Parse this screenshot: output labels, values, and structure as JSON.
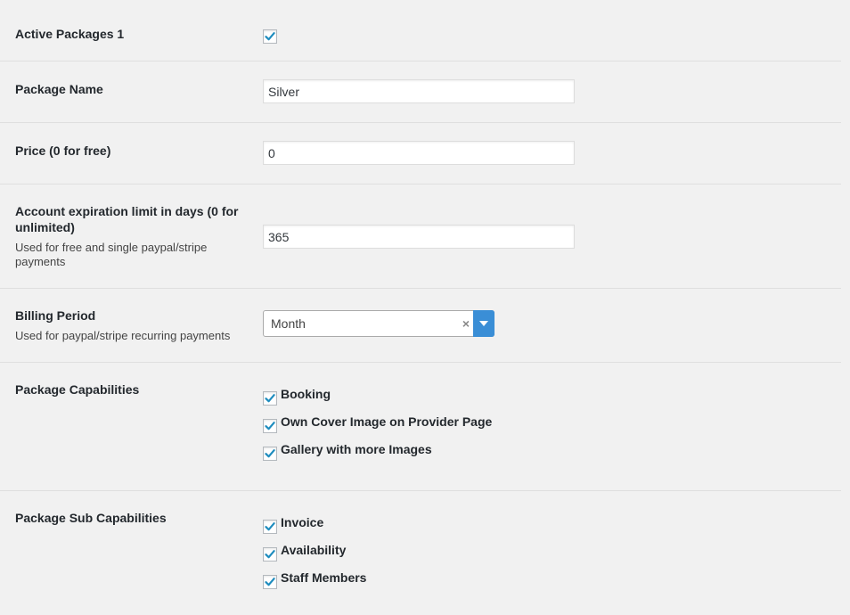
{
  "active_packages": {
    "label": "Active Packages 1",
    "checked": true
  },
  "package_name": {
    "label": "Package Name",
    "value": "Silver"
  },
  "price": {
    "label": "Price (0 for free)",
    "value": "0"
  },
  "expiration": {
    "label": "Account expiration limit in days (0 for unlimited)",
    "description": "Used for free and single paypal/stripe payments",
    "value": "365"
  },
  "billing_period": {
    "label": "Billing Period",
    "description": "Used for paypal/stripe recurring payments",
    "selected": "Month",
    "clear_symbol": "×"
  },
  "capabilities": {
    "label": "Package Capabilities",
    "items": [
      {
        "label": "Booking",
        "checked": true
      },
      {
        "label": "Own Cover Image on Provider Page",
        "checked": true
      },
      {
        "label": "Gallery with more Images",
        "checked": true
      }
    ]
  },
  "sub_capabilities": {
    "label": "Package Sub Capabilities",
    "items": [
      {
        "label": "Invoice",
        "checked": true
      },
      {
        "label": "Availability",
        "checked": true
      },
      {
        "label": "Staff Members",
        "checked": true
      }
    ]
  },
  "colors": {
    "background": "#f1f1f1",
    "checkmark": "#1e8cbe",
    "select_arrow": "#3a8ed6",
    "divider": "#dfdfdf"
  }
}
